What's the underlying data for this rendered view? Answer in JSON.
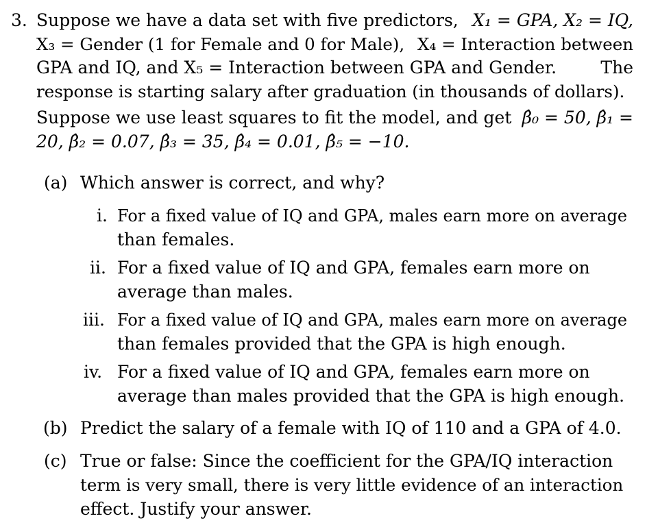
{
  "problem": {
    "number": "3.",
    "stem_lines": [
      [
        "Suppose we have a data set with five predictors,",
        "X₁ = GPA, X₂ = IQ,"
      ],
      [
        "X₃ = Gender (1 for Female and 0 for Male),",
        "X₄ = Interaction between"
      ],
      [
        "GPA and IQ, and X₅ = Interaction between GPA and Gender.",
        "The"
      ],
      [
        "response is starting salary after graduation (in thousands of dollars)."
      ],
      [
        "Suppose we use least squares to fit the model, and get",
        "β̂₀ = 50, β̂₁ ="
      ],
      [
        "20, β̂₂ = 0.07, β̂₃ = 35, β̂₄ = 0.01, β̂₅ = −10."
      ]
    ]
  },
  "parts": {
    "a": {
      "label": "(a)",
      "text": "Which answer is correct, and why?",
      "options": [
        {
          "label": "i.",
          "lines": [
            [
              "For a fixed value of IQ and GPA, males earn more on average"
            ],
            [
              "than females."
            ]
          ]
        },
        {
          "label": "ii.",
          "lines": [
            [
              "For a fixed value of IQ and GPA, females earn more on"
            ],
            [
              "average than males."
            ]
          ]
        },
        {
          "label": "iii.",
          "lines": [
            [
              "For a fixed value of IQ and GPA, males earn more on average"
            ],
            [
              "than females provided that the GPA is high enough."
            ]
          ]
        },
        {
          "label": "iv.",
          "lines": [
            [
              "For a fixed value of IQ and GPA, females earn more on"
            ],
            [
              "average than males provided that the GPA is high enough."
            ]
          ]
        }
      ]
    },
    "b": {
      "label": "(b)",
      "lines": [
        [
          "Predict the salary of a female with IQ of 110 and a GPA of 4.0."
        ]
      ]
    },
    "c": {
      "label": "(c)",
      "lines": [
        [
          "True or false: Since the coefficient for the GPA/IQ interaction"
        ],
        [
          "term is very small, there is very little evidence of an interaction"
        ],
        [
          "effect. Justify your answer."
        ]
      ]
    }
  }
}
